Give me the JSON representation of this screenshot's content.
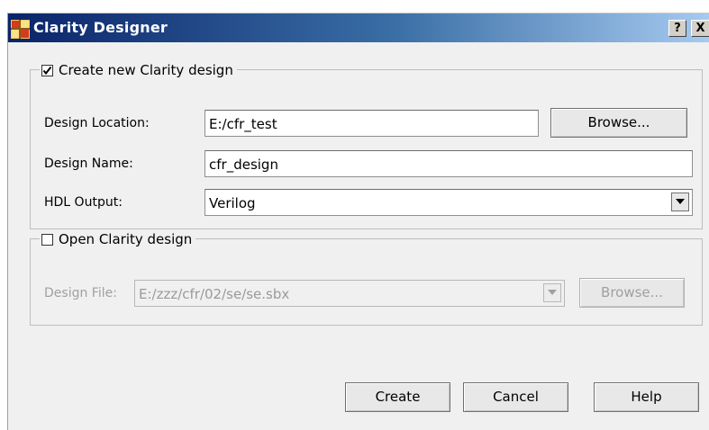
{
  "window": {
    "title": "Clarity Designer",
    "help_caption": "?",
    "close_caption": "X",
    "app_icon": "grid-app-icon"
  },
  "create_group": {
    "label": "Create new Clarity design",
    "checked": true,
    "design_location_label": "Design Location:",
    "design_location_value": "E:/cfr_test",
    "browse_label": "Browse...",
    "design_name_label": "Design Name:",
    "design_name_value": "cfr_design",
    "hdl_output_label": "HDL Output:",
    "hdl_output_value": "Verilog"
  },
  "open_group": {
    "label": "Open Clarity design",
    "checked": false,
    "design_file_label": "Design File:",
    "design_file_value": "E:/zzz/cfr/02/se/se.sbx",
    "browse_label": "Browse..."
  },
  "footer": {
    "create_label": "Create",
    "cancel_label": "Cancel",
    "help_label": "Help"
  },
  "colors": {
    "title_gradient_start": "#0a246a",
    "title_gradient_end": "#a6caf0",
    "dialog_bg": "#f0f0f0"
  }
}
